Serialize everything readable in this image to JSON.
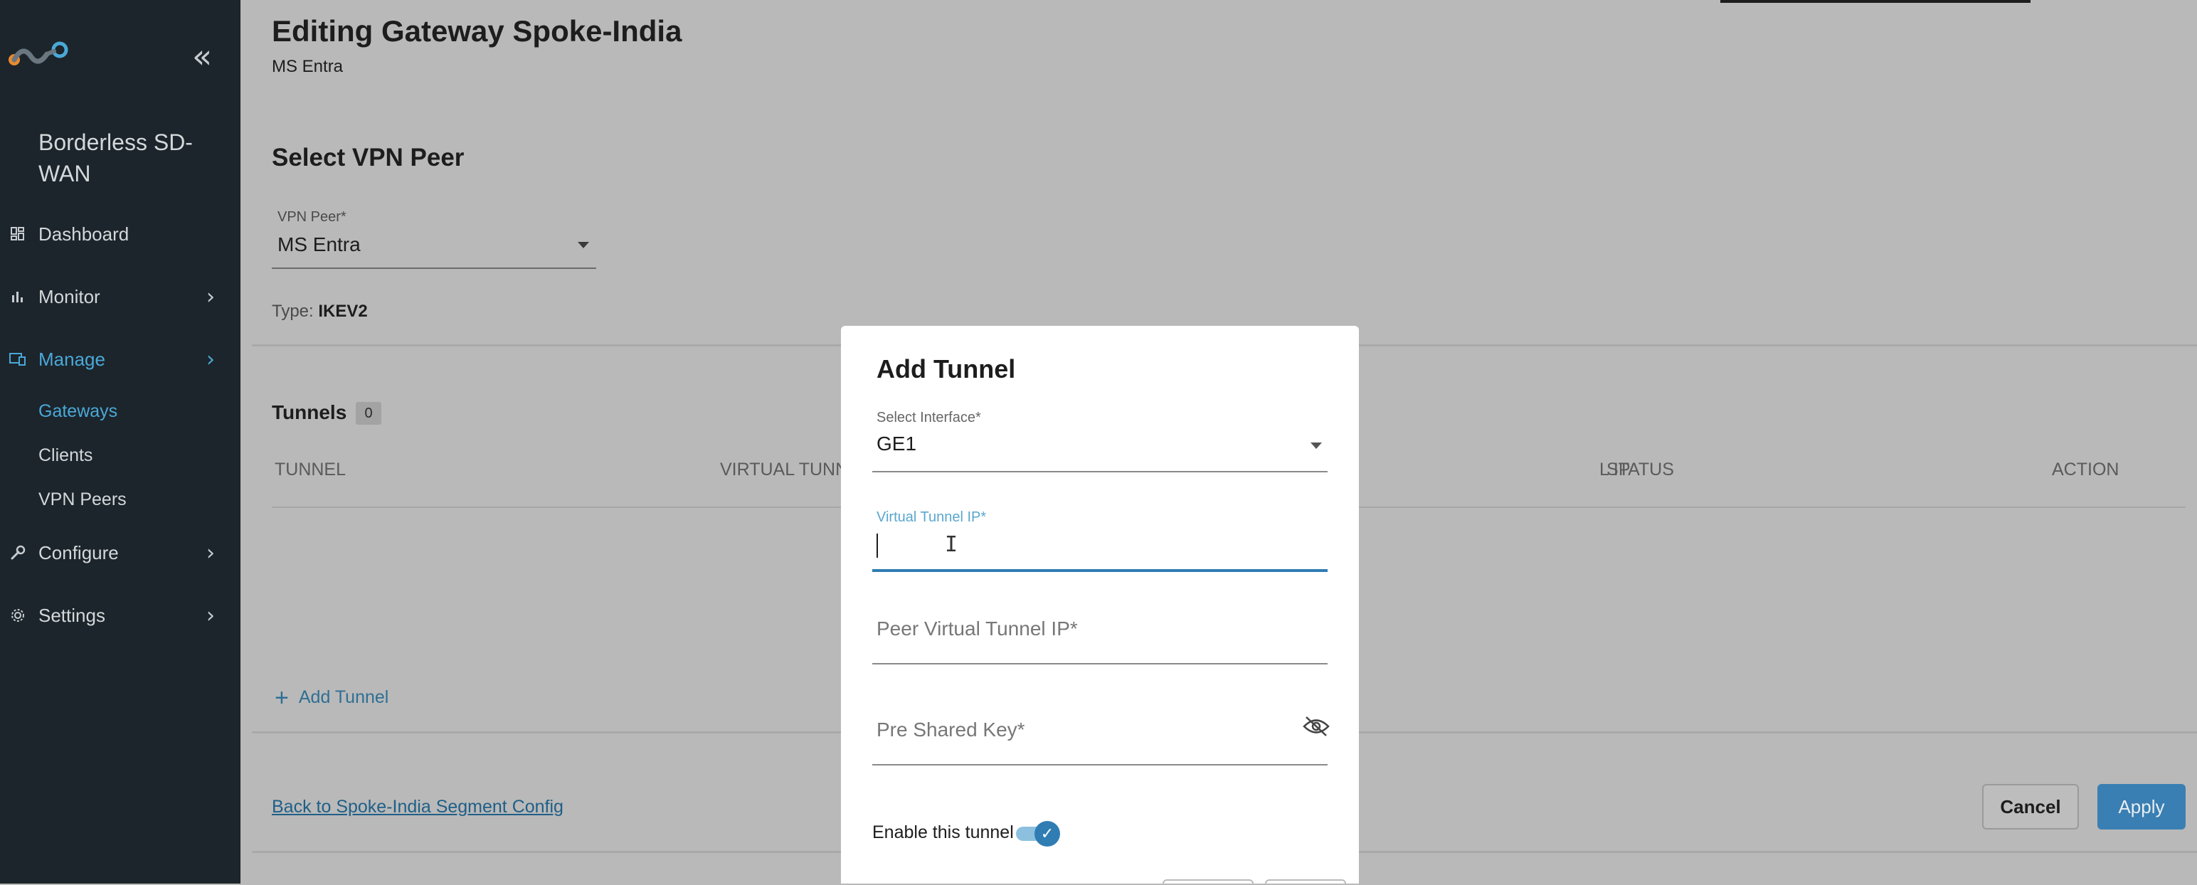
{
  "sidebar": {
    "brand": "Borderless SD-WAN",
    "collapse_icon": "double-chevron-left-icon",
    "nav": [
      {
        "label": "Dashboard",
        "icon": "grid-icon"
      },
      {
        "label": "Monitor",
        "icon": "bar-chart-icon"
      },
      {
        "label": "Manage",
        "icon": "manage-icon",
        "active": true
      },
      {
        "label": "Configure",
        "icon": "wrench-icon"
      },
      {
        "label": "Settings",
        "icon": "gear-icon"
      }
    ],
    "manage_sub": [
      {
        "label": "Gateways",
        "active": true
      },
      {
        "label": "Clients"
      },
      {
        "label": "VPN Peers"
      }
    ]
  },
  "header": {
    "title": "Editing Gateway Spoke-India",
    "subtitle": "MS Entra"
  },
  "vpn_section": {
    "title": "Select VPN Peer",
    "peer_label": "VPN Peer*",
    "peer_value": "MS Entra",
    "type_label": "Type:",
    "type_value": "IKEV2"
  },
  "tunnels": {
    "title": "Tunnels",
    "count": "0",
    "columns": [
      "TUNNEL",
      "VIRTUAL TUNN",
      "L IP",
      "STATUS",
      "ACTION"
    ],
    "add_label": "Add Tunnel"
  },
  "footer": {
    "back_link": "Back to Spoke-India Segment Config",
    "cancel": "Cancel",
    "apply": "Apply"
  },
  "modal": {
    "title": "Add Tunnel",
    "interface_label": "Select Interface*",
    "interface_value": "GE1",
    "vtip_label": "Virtual Tunnel IP*",
    "vtip_value": "",
    "peer_vtip_placeholder": "Peer Virtual Tunnel IP*",
    "psk_placeholder": "Pre Shared Key*",
    "enable_label": "Enable this tunnel",
    "enable_on": true
  },
  "colors": {
    "sidebar_bg": "#1c252b",
    "accent": "#4aa8d8",
    "primary_button": "#3a7fb3",
    "overlay_bg": "#b9b9b9"
  }
}
